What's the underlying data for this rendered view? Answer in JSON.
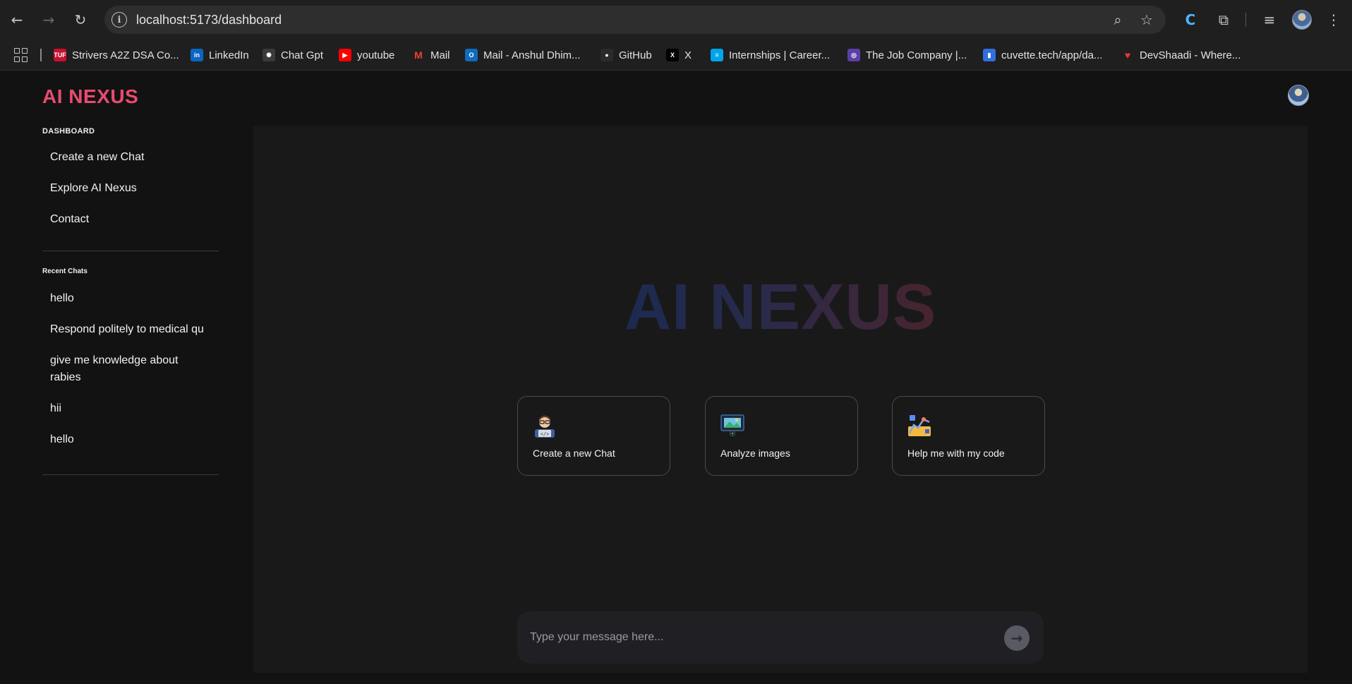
{
  "browser": {
    "url": "localhost:5173/dashboard",
    "bookmarks": [
      {
        "label": "Strivers A2Z DSA Co...",
        "icon": "tuf-icon",
        "badge": "TUF",
        "color": "#c8102e"
      },
      {
        "label": "LinkedIn",
        "icon": "linkedin-icon",
        "badge": "in",
        "color": "#0a66c2"
      },
      {
        "label": "Chat Gpt",
        "icon": "chatgpt-icon",
        "badge": "✺",
        "color": "#3a3a3a"
      },
      {
        "label": "youtube",
        "icon": "youtube-icon",
        "badge": "▶",
        "color": "#ff0000"
      },
      {
        "label": "Mail",
        "icon": "gmail-icon",
        "badge": "M",
        "color": "#d93025"
      },
      {
        "label": "Mail - Anshul Dhim...",
        "icon": "outlook-icon",
        "badge": "O",
        "color": "#0f6cbd"
      },
      {
        "label": "GitHub",
        "icon": "github-icon",
        "badge": "●",
        "color": "#2b2b2b"
      },
      {
        "label": "X",
        "icon": "x-icon",
        "badge": "X",
        "color": "#000000"
      },
      {
        "label": "Internships | Career...",
        "icon": "internshala-icon",
        "badge": "≡",
        "color": "#00a5ec"
      },
      {
        "label": "The Job Company |...",
        "icon": "jobcompany-icon",
        "badge": "◎",
        "color": "#5b3fa8"
      },
      {
        "label": "cuvette.tech/app/da...",
        "icon": "cuvette-icon",
        "badge": "▮",
        "color": "#2f6fe0"
      },
      {
        "label": "DevShaadi - Where...",
        "icon": "heart-icon",
        "badge": "♥",
        "color": "#1f1f1f"
      }
    ]
  },
  "app": {
    "logo": "AI NEXUS",
    "sidebar": {
      "dashboard_title": "DASHBOARD",
      "links": [
        "Create a new Chat",
        "Explore AI Nexus",
        "Contact"
      ],
      "recent_title": "Recent Chats",
      "recent": [
        "hello",
        "Respond politely to medical qu",
        "give me knowledge about rabies",
        "hii",
        "hello"
      ]
    },
    "hero_title": "AI NEXUS",
    "cards": [
      {
        "label": "Create a new Chat",
        "icon": "developer-icon"
      },
      {
        "label": "Analyze images",
        "icon": "image-icon"
      },
      {
        "label": "Help me with my code",
        "icon": "code-chart-icon"
      }
    ],
    "chat": {
      "placeholder": "Type your message here..."
    },
    "colors": {
      "accent": "#e94b6f",
      "background": "#121212",
      "panel": "#191919"
    }
  }
}
